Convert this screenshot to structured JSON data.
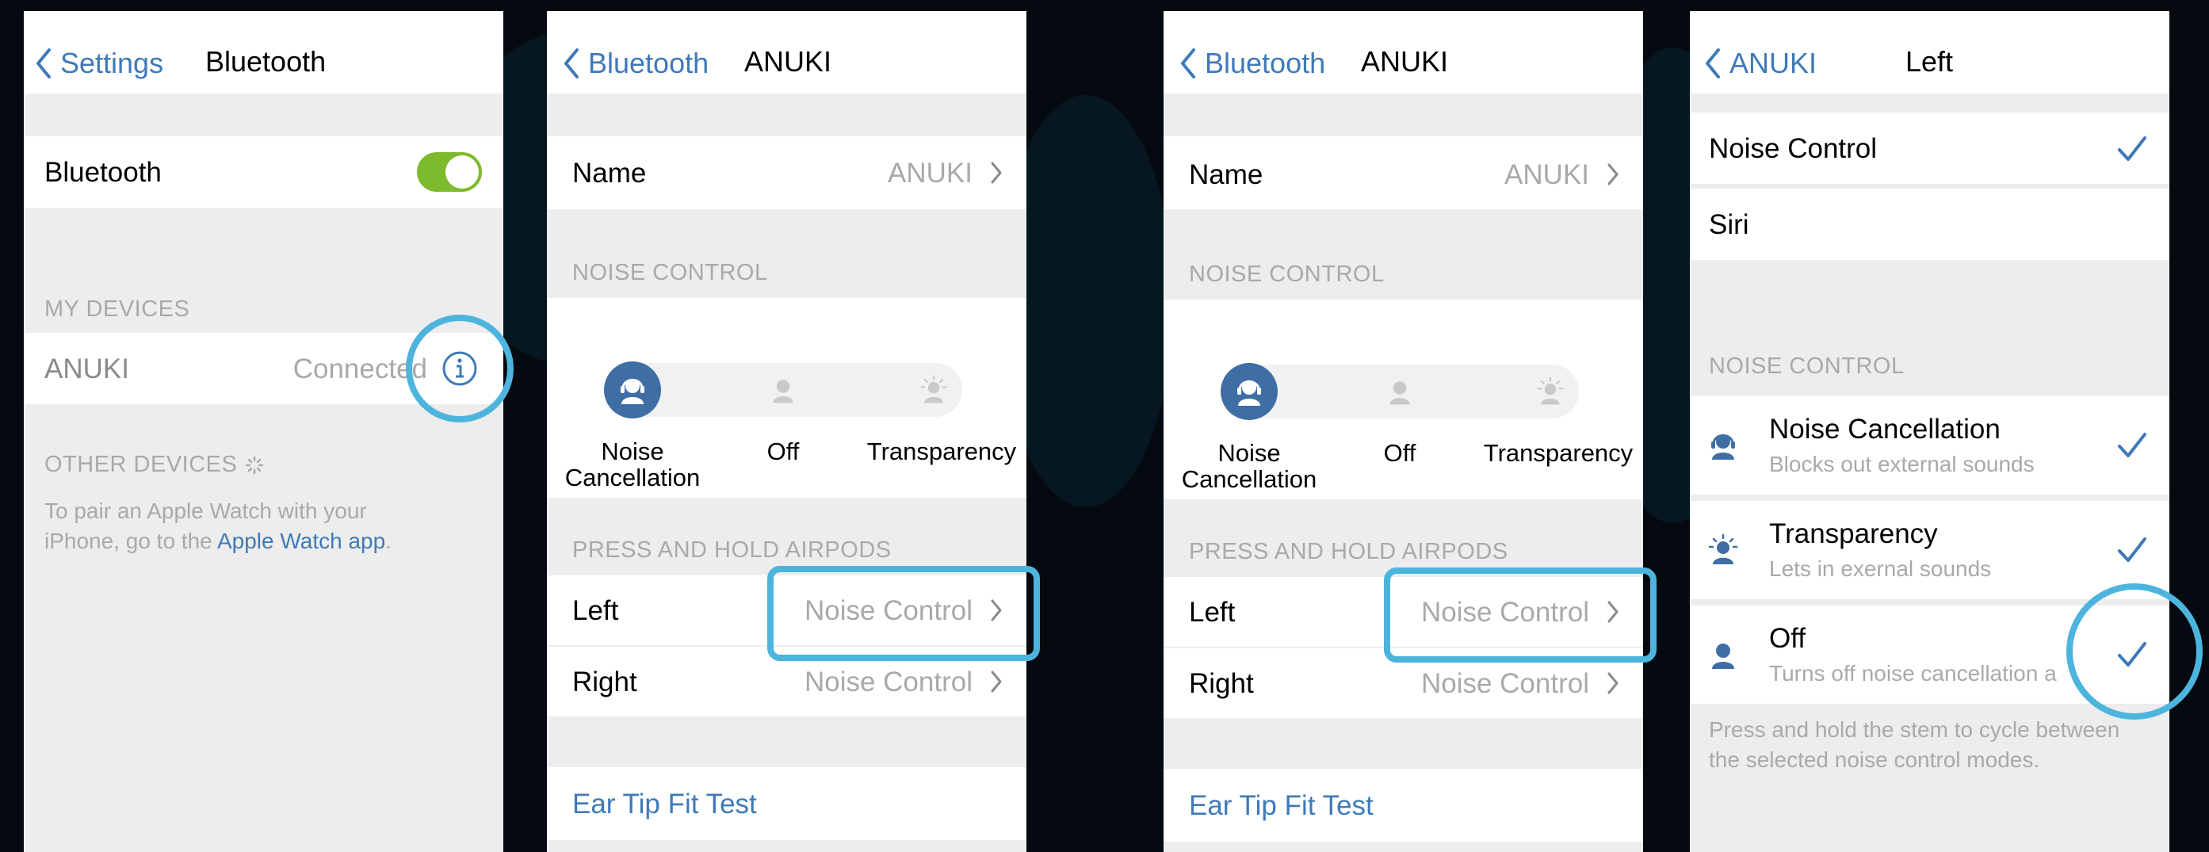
{
  "colors": {
    "accent": "#3f7ab8",
    "toggle_on": "#7dbb2c",
    "callout": "#4db4de",
    "muted": "#a9a9a9",
    "background": "#040a0f"
  },
  "panel1": {
    "back_label": "Settings",
    "title": "Bluetooth",
    "bluetooth_label": "Bluetooth",
    "bluetooth_on": true,
    "my_devices_header": "MY DEVICES",
    "device_name": "ANUKI",
    "device_status": "Connected",
    "info_icon": "info-icon",
    "other_devices_header": "OTHER DEVICES",
    "footer_text": "To pair an Apple Watch with your iPhone, go to the",
    "footer_link": "Apple Watch app",
    "footer_end": "."
  },
  "panel2": {
    "back_label": "Bluetooth",
    "title": "ANUKI",
    "name_label": "Name",
    "name_value": "ANUKI",
    "noise_header": "NOISE CONTROL",
    "modes": [
      "Noise Cancellation",
      "Off",
      "Transparency"
    ],
    "mode_line1": "Noise",
    "mode_line2": "Cancellation",
    "selected_mode": "Noise Cancellation",
    "press_header": "PRESS AND HOLD AIRPODS",
    "left_label": "Left",
    "left_value": "Noise Control",
    "right_label": "Right",
    "right_value": "Noise Control",
    "ear_tip": "Ear Tip Fit Test"
  },
  "panel3": {
    "back_label": "Bluetooth",
    "title": "ANUKI",
    "name_label": "Name",
    "name_value": "ANUKI",
    "noise_header": "NOISE CONTROL",
    "modes": [
      "Noise Cancellation",
      "Off",
      "Transparency"
    ],
    "mode_line1": "Noise",
    "mode_line2": "Cancellation",
    "selected_mode": "Noise Cancellation",
    "press_header": "PRESS AND HOLD AIRPODS",
    "left_label": "Left",
    "left_value": "Noise Control",
    "right_label": "Right",
    "right_value": "Noise Control",
    "ear_tip": "Ear Tip Fit Test"
  },
  "panel4": {
    "back_label": "ANUKI",
    "title": "Left",
    "option_noise_control": "Noise Control",
    "option_siri": "Siri",
    "selected_option": "Noise Control",
    "noise_header": "NOISE CONTROL",
    "items": [
      {
        "title": "Noise Cancellation",
        "subtitle": "Blocks out external sounds",
        "checked": true
      },
      {
        "title": "Transparency",
        "subtitle": "Lets in exernal sounds",
        "checked": true
      },
      {
        "title": "Off",
        "subtitle": "Turns off noise cancellation a",
        "checked": true
      }
    ],
    "footer": "Press and hold the stem to cycle between the selected noise control modes."
  }
}
